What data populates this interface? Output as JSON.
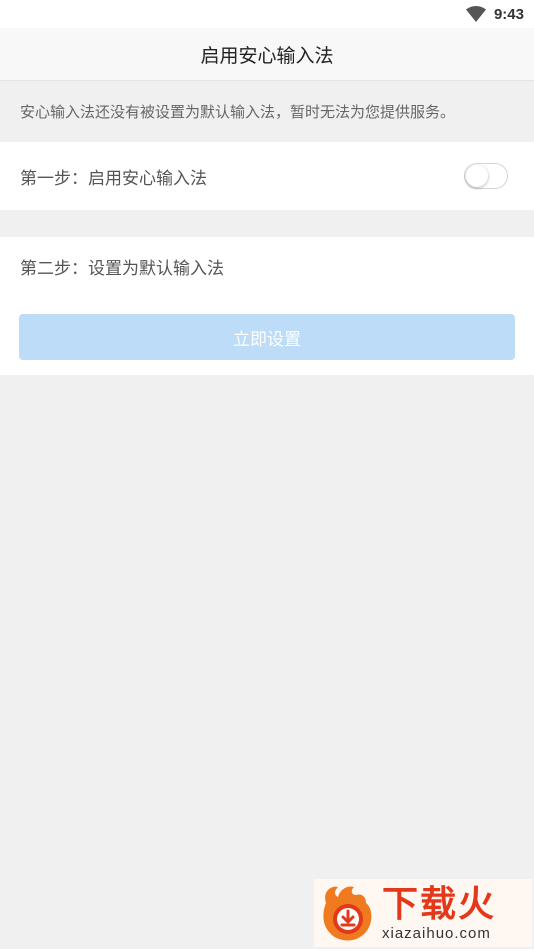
{
  "status_bar": {
    "time": "9:43",
    "wifi_icon": "wifi-icon"
  },
  "header": {
    "title": "启用安心输入法"
  },
  "notice": {
    "text": "安心输入法还没有被设置为默认输入法，暂时无法为您提供服务。"
  },
  "step1": {
    "label": "第一步：启用安心输入法",
    "toggle_on": false
  },
  "step2": {
    "label": "第二步：设置为默认输入法",
    "button_label": "立即设置"
  },
  "colors": {
    "button_bg": "#bcdcf7",
    "page_bg": "#f0f0f0",
    "watermark_brand": "#e4381a"
  },
  "watermark": {
    "brand": "下载火",
    "domain": "xiazaihuo.com",
    "logo_icon": "flame-download-icon"
  }
}
